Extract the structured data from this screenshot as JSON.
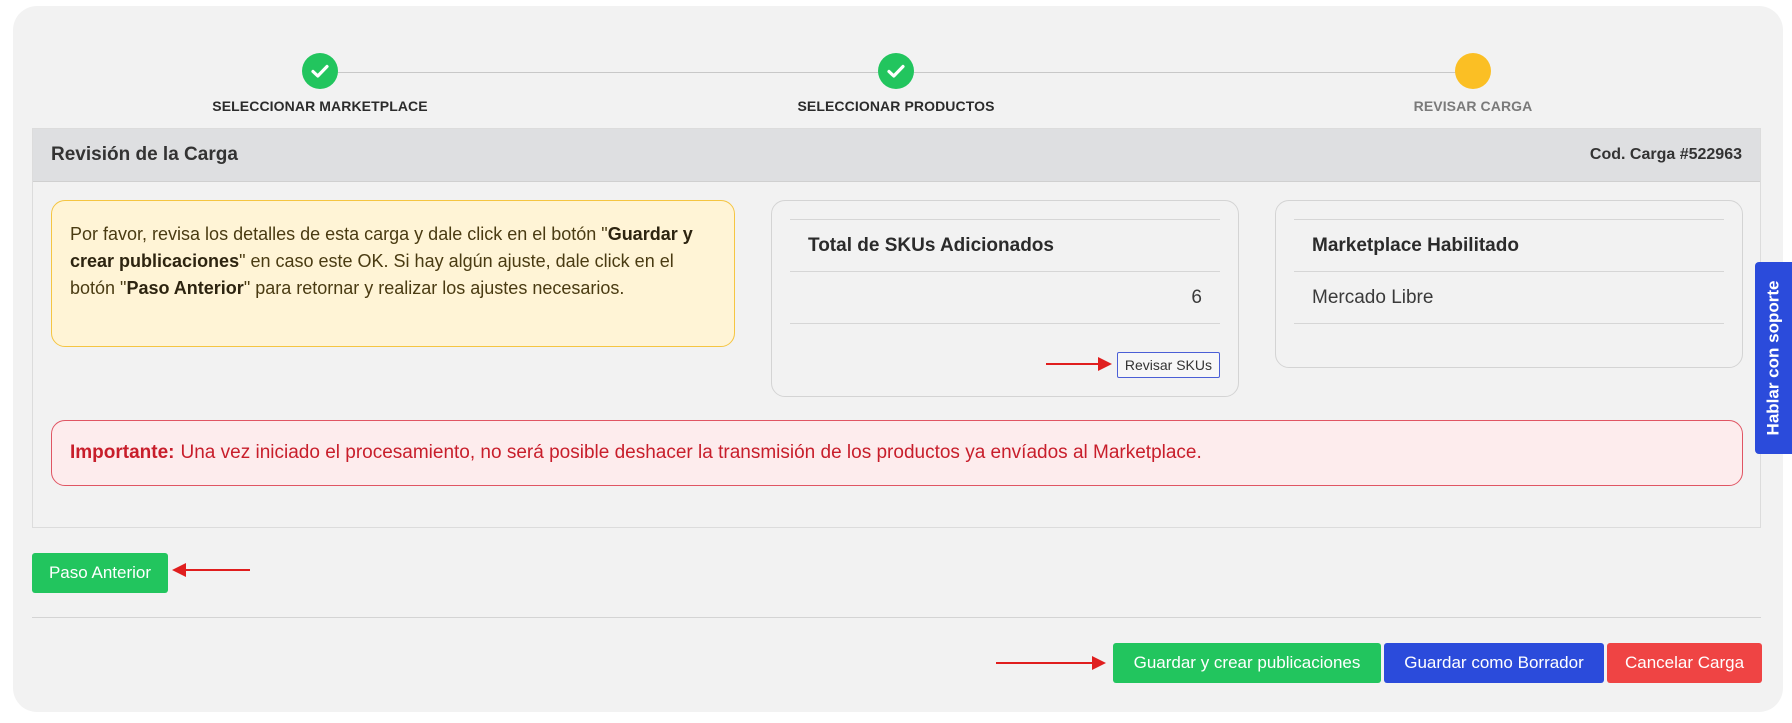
{
  "stepper": {
    "steps": [
      {
        "label": "SELECCIONAR MARKETPLACE",
        "status": "done"
      },
      {
        "label": "SELECCIONAR PRODUCTOS",
        "status": "done"
      },
      {
        "label": "REVISAR CARGA",
        "status": "current"
      }
    ]
  },
  "panel": {
    "title": "Revisión de la Carga",
    "code": "Cod. Carga #522963"
  },
  "info": {
    "t1": "Por favor, revisa los detalles de esta carga y dale click en el botón \"",
    "b1": "Guardar y crear publicaciones",
    "t2": "\" en caso este OK. Si hay algún ajuste, dale click en el botón \"",
    "b2": "Paso Anterior",
    "t3": "\" para retornar y realizar los ajustes necesarios."
  },
  "skus_card": {
    "title": "Total de SKUs Adicionados",
    "value": "6",
    "button_label": "Revisar SKUs"
  },
  "marketplace_card": {
    "title": "Marketplace Habilitado",
    "value": "Mercado Libre"
  },
  "alert": {
    "strong": "Importante:",
    "text": "Una vez iniciado el procesamiento, no será posible deshacer la transmisión de los productos ya envíados al Marketplace."
  },
  "buttons": {
    "previous": "Paso Anterior",
    "save_publish": "Guardar y crear publicaciones",
    "save_draft": "Guardar como Borrador",
    "cancel": "Cancelar Carga"
  },
  "support": {
    "label": "Hablar con soporte"
  },
  "colors": {
    "success": "#22c55e",
    "current_step": "#fbbf24",
    "primary": "#2b4bdb",
    "danger": "#ef4444",
    "annotation_arrow": "#e01e1e"
  }
}
